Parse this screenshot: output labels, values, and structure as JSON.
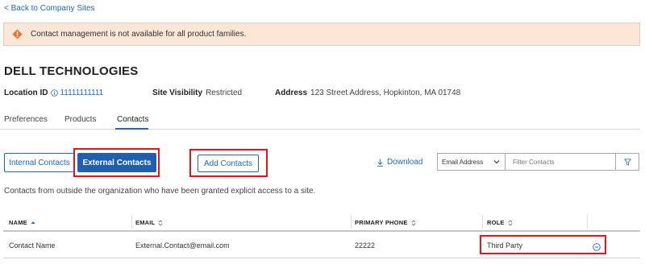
{
  "nav": {
    "back_link": "< Back to Company Sites"
  },
  "banner": {
    "icon": "warning-icon",
    "message": "Contact management is not available for all product families.",
    "color": "#fbe6d8"
  },
  "company": {
    "name": "DELL TECHNOLOGIES"
  },
  "details": {
    "location_label": "Location ID",
    "location_value": "11111111111",
    "visibility_label": "Site Visibility",
    "visibility_value": "Restricted",
    "address_label": "Address",
    "address_value": "123 Street Address, Hopkinton, MA 01748"
  },
  "tabs": [
    {
      "label": "Preferences"
    },
    {
      "label": "Products"
    },
    {
      "label": "Contacts",
      "active": true
    }
  ],
  "toolbar": {
    "internal_label": "Internal Contacts",
    "external_label": "External Contacts",
    "add_label": "Add Contacts",
    "download_label": "Download",
    "filter_select": "Email Address",
    "filter_placeholder": "Filter Contacts"
  },
  "description": "Contacts from outside the organization who have been granted explicit access to a site.",
  "table": {
    "headers": [
      "NAME",
      "EMAIL",
      "PRIMARY PHONE",
      "ROLE"
    ],
    "rows": [
      {
        "name": "Contact Name",
        "email": "External.Contact@email.com",
        "phone": "22222",
        "role": "Third Party"
      }
    ]
  },
  "colors": {
    "accent": "#1a6bbd",
    "primary_button": "#1f5fae",
    "highlight": "#e8141a",
    "warning": "#e9722e"
  }
}
